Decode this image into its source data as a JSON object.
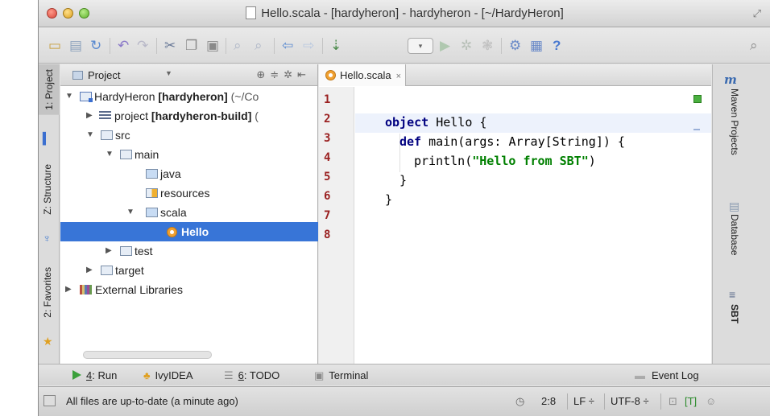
{
  "window": {
    "title": "Hello.scala - [hardyheron] - hardyheron - [~/HardyHeron]"
  },
  "left_strip": {
    "tabs": [
      "1: Project",
      "Z: Structure",
      "2: Favorites"
    ]
  },
  "project_panel": {
    "title": "Project",
    "tree": [
      {
        "label": "HardyHeron",
        "bold": "[hardyheron]",
        "suffix": " (~/Co"
      },
      {
        "label": "project",
        "bold": "[hardyheron-build]",
        "suffix": " ("
      },
      {
        "label": "src"
      },
      {
        "label": "main"
      },
      {
        "label": "java"
      },
      {
        "label": "resources"
      },
      {
        "label": "scala"
      },
      {
        "label": "Hello"
      },
      {
        "label": "test"
      },
      {
        "label": "target"
      },
      {
        "label": "External Libraries"
      }
    ]
  },
  "editor": {
    "tab_label": "Hello.scala",
    "tab_close": "×",
    "line_numbers": [
      "1",
      "2",
      "3",
      "4",
      "5",
      "6",
      "7",
      "8"
    ],
    "code": {
      "l2_kw": "object",
      "l2_rest": " Hello {",
      "l3_kw": "def",
      "l3_rest": " main(args: Array[String]) {",
      "l4_pre": "println(",
      "l4_str": "\"Hello from SBT\"",
      "l4_post": ")",
      "l5": "}",
      "l6": "}"
    }
  },
  "right_strip": {
    "tabs": [
      "Maven Projects",
      "Database",
      "SBT"
    ]
  },
  "bottom_tools": {
    "run_num": "4",
    "run_label": ": Run",
    "ivy": "IvyIDEA",
    "todo_num": "6",
    "todo_label": ": TODO",
    "terminal": "Terminal",
    "event_log": "Event Log"
  },
  "status": {
    "message": "All files are up-to-date (a minute ago)",
    "position": "2:8",
    "line_sep": "LF ÷",
    "encoding": "UTF-8 ÷",
    "insert_mode": "[T]"
  }
}
